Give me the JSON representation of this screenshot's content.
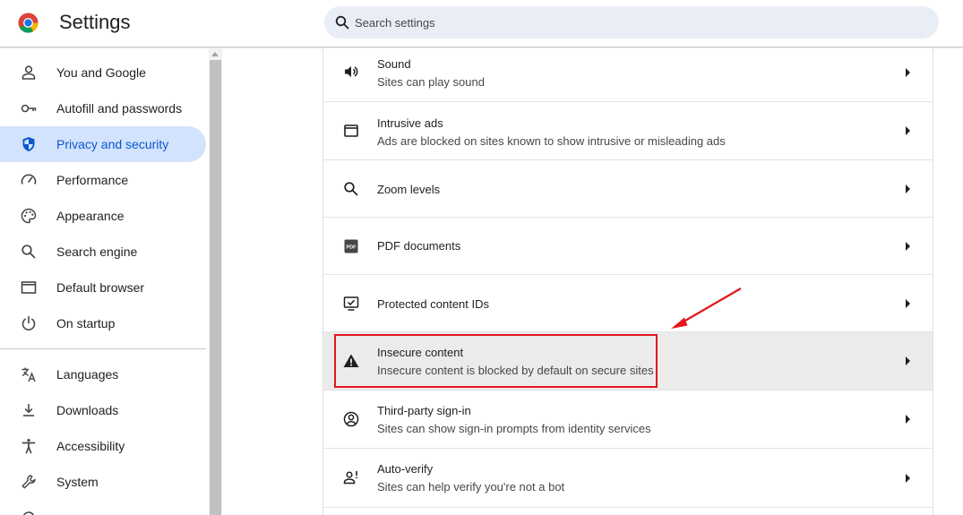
{
  "header": {
    "title": "Settings",
    "search_placeholder": "Search settings"
  },
  "sidebar": {
    "items": [
      {
        "label": "You and Google",
        "icon": "person-icon"
      },
      {
        "label": "Autofill and passwords",
        "icon": "key-icon"
      },
      {
        "label": "Privacy and security",
        "icon": "shield-icon",
        "active": true
      },
      {
        "label": "Performance",
        "icon": "speedometer-icon"
      },
      {
        "label": "Appearance",
        "icon": "palette-icon"
      },
      {
        "label": "Search engine",
        "icon": "search-icon"
      },
      {
        "label": "Default browser",
        "icon": "browser-window-icon"
      },
      {
        "label": "On startup",
        "icon": "power-icon"
      },
      {
        "label": "Languages",
        "icon": "translate-icon"
      },
      {
        "label": "Downloads",
        "icon": "download-icon"
      },
      {
        "label": "Accessibility",
        "icon": "accessibility-icon"
      },
      {
        "label": "System",
        "icon": "wrench-icon"
      }
    ]
  },
  "content": {
    "rows": [
      {
        "title": "Sound",
        "subtitle": "Sites can play sound",
        "icon": "speaker-icon"
      },
      {
        "title": "Intrusive ads",
        "subtitle": "Ads are blocked on sites known to show intrusive or misleading ads",
        "icon": "browser-window-icon"
      },
      {
        "title": "Zoom levels",
        "subtitle": "",
        "icon": "search-icon"
      },
      {
        "title": "PDF documents",
        "subtitle": "",
        "icon": "pdf-icon",
        "icon_text": "PDF"
      },
      {
        "title": "Protected content IDs",
        "subtitle": "",
        "icon": "protected-content-icon"
      },
      {
        "title": "Insecure content",
        "subtitle": "Insecure content is blocked by default on secure sites",
        "icon": "warning-icon",
        "highlighted": true
      },
      {
        "title": "Third-party sign-in",
        "subtitle": "Sites can show sign-in prompts from identity services",
        "icon": "account-circle-icon"
      },
      {
        "title": "Auto-verify",
        "subtitle": "Sites can help verify you're not a bot",
        "icon": "person-verify-icon"
      }
    ]
  },
  "colors": {
    "accent": "#0b57d0",
    "active_bg": "#d3e3fd",
    "annotation": "#e3161c",
    "highlight_row": "#ebebeb"
  }
}
